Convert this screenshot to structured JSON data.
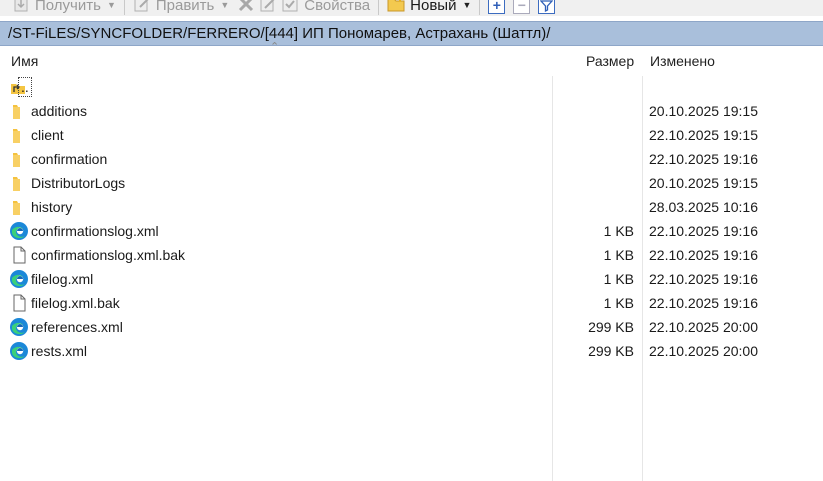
{
  "toolbar": {
    "get_label": "Получить",
    "edit_label": "Править",
    "properties_label": "Свойства",
    "new_label": "Новый",
    "colors": {
      "disabled": "#9a9a9a",
      "accent": "#2f5fb8"
    }
  },
  "path": "/ST-FiLES/SYNCFOLDER/FERRERO/[444] ИП Пономарев, Астрахань (Шаттл)/",
  "columns": {
    "name": "Имя",
    "size": "Размер",
    "modified": "Изменено"
  },
  "rows": [
    {
      "name": "..",
      "size": "",
      "date": "",
      "icon": "parent-dir-icon"
    },
    {
      "name": "additions",
      "size": "",
      "date": "20.10.2025 19:15",
      "icon": "folder-icon"
    },
    {
      "name": "client",
      "size": "",
      "date": "22.10.2025 19:15",
      "icon": "folder-icon"
    },
    {
      "name": "confirmation",
      "size": "",
      "date": "22.10.2025 19:16",
      "icon": "folder-icon"
    },
    {
      "name": "DistributorLogs",
      "size": "",
      "date": "20.10.2025 19:15",
      "icon": "folder-icon"
    },
    {
      "name": "history",
      "size": "",
      "date": "28.03.2025 10:16",
      "icon": "folder-icon"
    },
    {
      "name": "confirmationslog.xml",
      "size": "1 KB",
      "date": "22.10.2025 19:16",
      "icon": "edge-file-icon"
    },
    {
      "name": "confirmationslog.xml.bak",
      "size": "1 KB",
      "date": "22.10.2025 19:16",
      "icon": "blank-file-icon"
    },
    {
      "name": "filelog.xml",
      "size": "1 KB",
      "date": "22.10.2025 19:16",
      "icon": "edge-file-icon"
    },
    {
      "name": "filelog.xml.bak",
      "size": "1 KB",
      "date": "22.10.2025 19:16",
      "icon": "blank-file-icon"
    },
    {
      "name": "references.xml",
      "size": "299 KB",
      "date": "22.10.2025 20:00",
      "icon": "edge-file-icon"
    },
    {
      "name": "rests.xml",
      "size": "299 KB",
      "date": "22.10.2025 20:00",
      "icon": "edge-file-icon"
    }
  ]
}
